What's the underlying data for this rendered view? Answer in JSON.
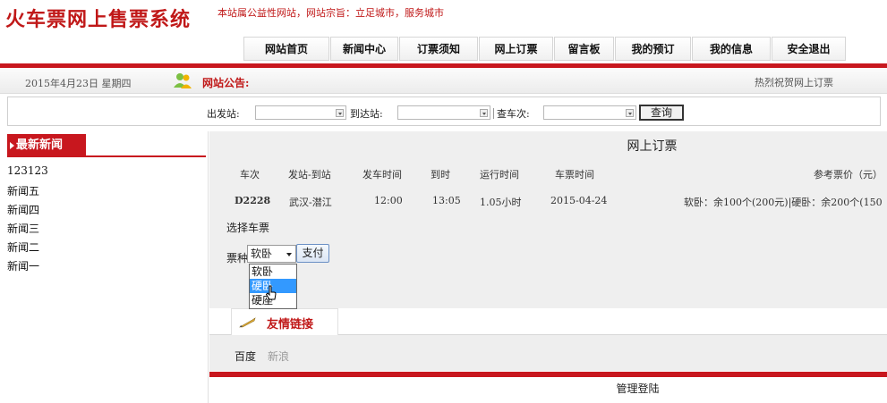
{
  "header": {
    "site_title": "火车票网上售票系统",
    "slogan": "本站属公益性网站，网站宗旨：立足城市，服务城市"
  },
  "nav": [
    {
      "label": "网站首页"
    },
    {
      "label": "新闻中心"
    },
    {
      "label": "订票须知"
    },
    {
      "label": "网上订票"
    },
    {
      "label": "留言板"
    },
    {
      "label": "我的预订"
    },
    {
      "label": "我的信息"
    },
    {
      "label": "安全退出"
    }
  ],
  "notice_bar": {
    "date": "2015年4月23日 星期四",
    "label": "网站公告:",
    "text": "热烈祝贺网上订票",
    "icon": "user-group-icon"
  },
  "search": {
    "from_label": "出发站:",
    "to_label": "到达站:",
    "train_label": "查车次:",
    "query_button": "查询"
  },
  "news": {
    "title": "最新新闻",
    "items": [
      "123123",
      "新闻五",
      "新闻四",
      "新闻三",
      "新闻二",
      "新闻一"
    ]
  },
  "booking": {
    "title": "网上订票",
    "headers": [
      "车次",
      "发站-到站",
      "发车时间",
      "到时",
      "运行时间",
      "车票时间",
      "参考票价（元）"
    ],
    "row": {
      "train_no": "D2228",
      "route": "武汉-潜江",
      "depart": "12:00",
      "arrive": "13:05",
      "duration": "1.05小时",
      "date": "2015-04-24",
      "price": "软卧：余100个(200元)|硬卧：余200个(150"
    },
    "choose_label": "选择车票",
    "ticket_type_label": "票种",
    "ticket_type_selected": "软卧",
    "ticket_type_options": [
      "软卧",
      "硬卧",
      "硬座"
    ],
    "pay_button": "支付"
  },
  "links": {
    "title": "友情链接",
    "items": [
      "百度",
      "新浪"
    ]
  },
  "manage": {
    "title": "管理登陆"
  },
  "colors": {
    "brand_red": "#c8171e",
    "highlight_blue": "#3399ff"
  }
}
